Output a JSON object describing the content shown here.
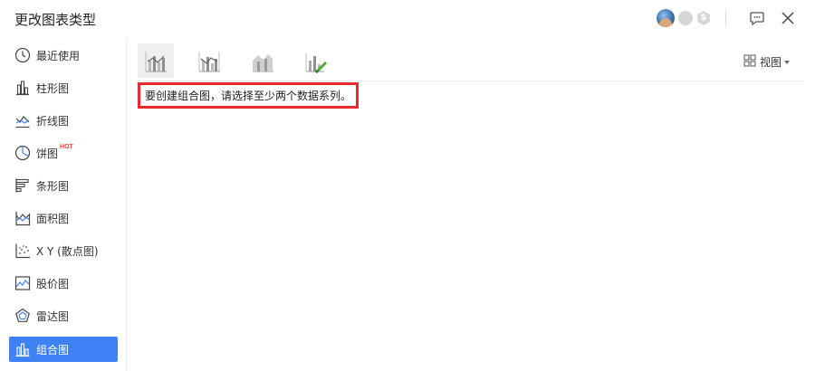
{
  "window": {
    "title": "更改图表类型"
  },
  "header_icons": [
    "avatar",
    "coin-badge-icon",
    "dollar-badge-icon",
    "comment-icon",
    "close-icon"
  ],
  "header": {
    "dollar_symbol": "$"
  },
  "sidebar": {
    "items": [
      {
        "label": "最近使用",
        "icon": "clock-icon",
        "name": "sidebar-item-recent"
      },
      {
        "label": "柱形图",
        "icon": "column-chart-icon",
        "name": "sidebar-item-column"
      },
      {
        "label": "折线图",
        "icon": "line-chart-icon",
        "name": "sidebar-item-line"
      },
      {
        "label": "饼图",
        "icon": "pie-chart-icon",
        "name": "sidebar-item-pie",
        "badge": "HOT"
      },
      {
        "label": "条形图",
        "icon": "bar-chart-icon",
        "name": "sidebar-item-bar"
      },
      {
        "label": "面积图",
        "icon": "area-chart-icon",
        "name": "sidebar-item-area"
      },
      {
        "label": "X Y (散点图)",
        "icon": "scatter-chart-icon",
        "name": "sidebar-item-scatter"
      },
      {
        "label": "股价图",
        "icon": "stock-chart-icon",
        "name": "sidebar-item-stock"
      },
      {
        "label": "雷达图",
        "icon": "radar-chart-icon",
        "name": "sidebar-item-radar"
      },
      {
        "label": "组合图",
        "icon": "combo-chart-icon",
        "name": "sidebar-item-combo",
        "active": true
      }
    ]
  },
  "content": {
    "chart_type_thumbs": [
      "combo-column-line-icon",
      "combo-column-line-secondary-axis-icon",
      "combo-stacked-area-column-icon",
      "custom-combo-icon"
    ],
    "view_label": "视图",
    "message": "要创建组合图，请选择至少两个数据系列。"
  },
  "colors": {
    "accent": "#3f82f5",
    "highlight_border": "#ea2a2a",
    "hot_badge": "#f4433c",
    "custom_pencil": "#4caf2f"
  }
}
